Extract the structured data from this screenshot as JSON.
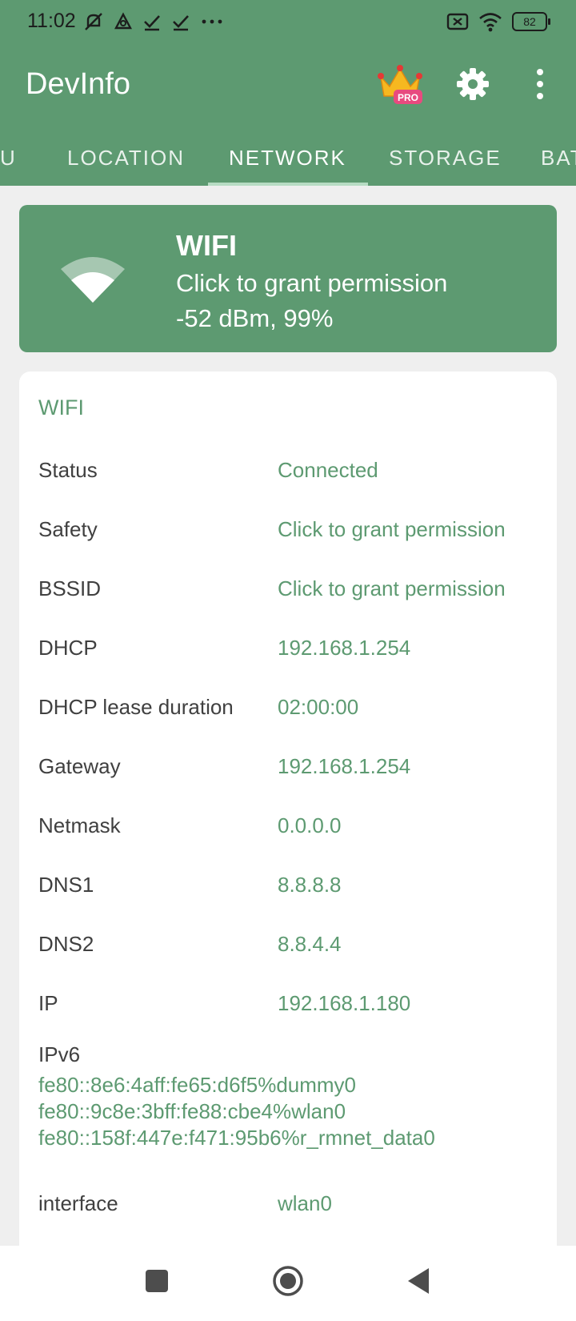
{
  "status_bar": {
    "time": "11:02",
    "battery": "82"
  },
  "app_bar": {
    "title": "DevInfo",
    "pro_badge": "PRO"
  },
  "tabs": [
    {
      "label": "U"
    },
    {
      "label": "LOCATION"
    },
    {
      "label": "NETWORK"
    },
    {
      "label": "STORAGE"
    },
    {
      "label": "BAT"
    }
  ],
  "wifi_card": {
    "title": "WIFI",
    "subtitle": "Click to grant permission",
    "signal": "-52 dBm, 99%"
  },
  "details": {
    "section_title": "WIFI",
    "rows": [
      {
        "label": "Status",
        "value": "Connected"
      },
      {
        "label": "Safety",
        "value": "Click to grant permission"
      },
      {
        "label": "BSSID",
        "value": "Click to grant permission"
      },
      {
        "label": "DHCP",
        "value": "192.168.1.254"
      },
      {
        "label": "DHCP lease duration",
        "value": "02:00:00"
      },
      {
        "label": "Gateway",
        "value": "192.168.1.254"
      },
      {
        "label": "Netmask",
        "value": "0.0.0.0"
      },
      {
        "label": "DNS1",
        "value": "8.8.8.8"
      },
      {
        "label": "DNS2",
        "value": "8.8.4.4"
      },
      {
        "label": "IP",
        "value": "192.168.1.180"
      }
    ],
    "ipv6": {
      "label": "IPv6",
      "values": [
        "fe80::8e6:4aff:fe65:d6f5%dummy0",
        "fe80::9c8e:3bff:fe88:cbe4%wlan0",
        "fe80::158f:447e:f471:95b6%r_rmnet_data0"
      ]
    },
    "interface": {
      "label": "interface",
      "value": "wlan0"
    }
  },
  "colors": {
    "brand": "#5d9a71",
    "background": "#efefef",
    "card": "#ffffff",
    "label_text": "#404040"
  }
}
